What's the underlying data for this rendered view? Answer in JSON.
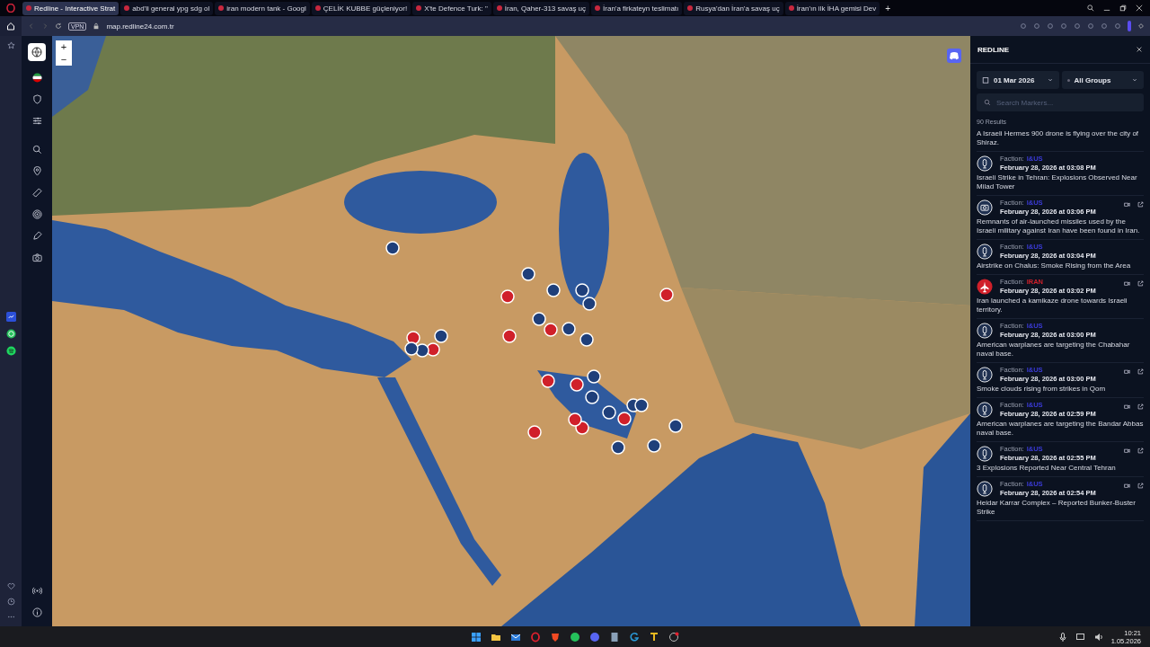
{
  "browser": {
    "tabs": [
      {
        "title": "Redline - Interactive Strat",
        "selected": true
      },
      {
        "title": "abd'li general ypg sdg ol",
        "selected": false
      },
      {
        "title": "iran modern tank - Googl",
        "selected": false
      },
      {
        "title": "ÇELİK KUBBE güçleniyor!",
        "selected": false
      },
      {
        "title": "X'te Defence Turk: \"",
        "selected": false
      },
      {
        "title": "İran, Qaher-313 savaş uç",
        "selected": false
      },
      {
        "title": "İran'a firkateyn teslimatı",
        "selected": false
      },
      {
        "title": "Rusya'dan İran'a savaş uç",
        "selected": false
      },
      {
        "title": "İran'ın ilk İHA gemisi Dev",
        "selected": false
      }
    ],
    "new_tab": "+",
    "vpn": "VPN",
    "url": "map.redline24.com.tr"
  },
  "map": {
    "zoom_in": "+",
    "zoom_out": "−"
  },
  "panel": {
    "title": "REDLINE",
    "date": "01 Mar 2026",
    "group": "All Groups",
    "search": {
      "placeholder": "Search Markers..."
    },
    "results": "90 Results",
    "partial_text": "A Israeli Hermes 900 drone is flying over the city of Shiraz.",
    "events": [
      {
        "kind": "bomb",
        "faction_label": "Faction:",
        "faction": "I&US",
        "color": "#3b3bd6",
        "time": "February 28, 2026 at 03:08 PM",
        "media": false,
        "text": "Israeli Strike in Tehran: Explosions Observed Near Milad Tower"
      },
      {
        "kind": "camera",
        "faction_label": "Faction:",
        "faction": "I&US",
        "color": "#3b3bd6",
        "time": "February 28, 2026 at 03:06 PM",
        "media": true,
        "text": "Remnants of air-launched missiles used by the Israeli military against Iran have been found in Iran."
      },
      {
        "kind": "bomb",
        "faction_label": "Faction:",
        "faction": "I&US",
        "color": "#3b3bd6",
        "time": "February 28, 2026 at 03:04 PM",
        "media": false,
        "text": "Airstrike on Chalus: Smoke Rising from the Area"
      },
      {
        "kind": "jet",
        "faction_label": "Faction:",
        "faction": "IRAN",
        "color": "#d0202a",
        "time": "February 28, 2026 at 03:02 PM",
        "media": true,
        "text": "Iran launched a kamikaze drone towards Israeli territory."
      },
      {
        "kind": "bomb",
        "faction_label": "Faction:",
        "faction": "I&US",
        "color": "#3b3bd6",
        "time": "February 28, 2026 at 03:00 PM",
        "media": false,
        "text": "American warplanes are targeting the Chabahar naval base."
      },
      {
        "kind": "bomb",
        "faction_label": "Faction:",
        "faction": "I&US",
        "color": "#3b3bd6",
        "time": "February 28, 2026 at 03:00 PM",
        "media": true,
        "text": "Smoke clouds rising from strikes in Qom"
      },
      {
        "kind": "bomb",
        "faction_label": "Faction:",
        "faction": "I&US",
        "color": "#3b3bd6",
        "time": "February 28, 2026 at 02:59 PM",
        "media": true,
        "text": "American warplanes are targeting the Bandar Abbas naval base."
      },
      {
        "kind": "bomb",
        "faction_label": "Faction:",
        "faction": "I&US",
        "color": "#3b3bd6",
        "time": "February 28, 2026 at 02:55 PM",
        "media": true,
        "text": "3 Explosions Reported Near Central Tehran"
      },
      {
        "kind": "bomb",
        "faction_label": "Faction:",
        "faction": "I&US",
        "color": "#3b3bd6",
        "time": "February 28, 2026 at 02:54 PM",
        "media": true,
        "text": "Heidar Karrar Complex – Reported Bunker-Buster Strike"
      }
    ]
  },
  "taskbar": {
    "time": "10:21",
    "date": "1.05.2026"
  }
}
